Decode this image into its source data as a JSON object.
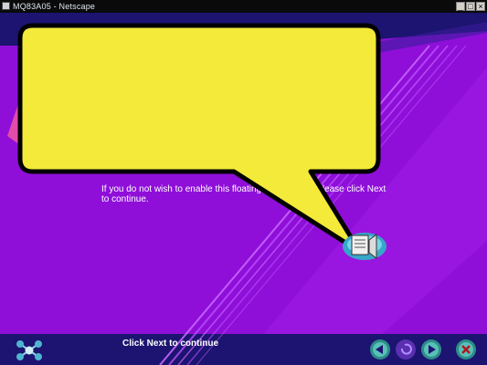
{
  "window": {
    "title": "MQ83A05 - Netscape"
  },
  "content": {
    "body_text": "If you do not wish to enable this floating help feature, please click Next to continue.",
    "footer_text": "Click Next to continue"
  },
  "icons": {
    "app": "netscape-icon",
    "minimize": "minimize-icon",
    "maximize": "maximize-icon",
    "close": "close-icon",
    "logo": "network-logo-icon",
    "speaker": "speaker-icon",
    "back": "back-arrow-icon",
    "replay": "replay-icon",
    "next": "next-arrow-icon",
    "exit": "exit-icon"
  },
  "colors": {
    "background": "#8f0fd9",
    "navy_band": "#1c1470",
    "bubble_fill": "#f3ea3a",
    "bubble_border": "#000000",
    "nav_button": "#2e8c88"
  }
}
